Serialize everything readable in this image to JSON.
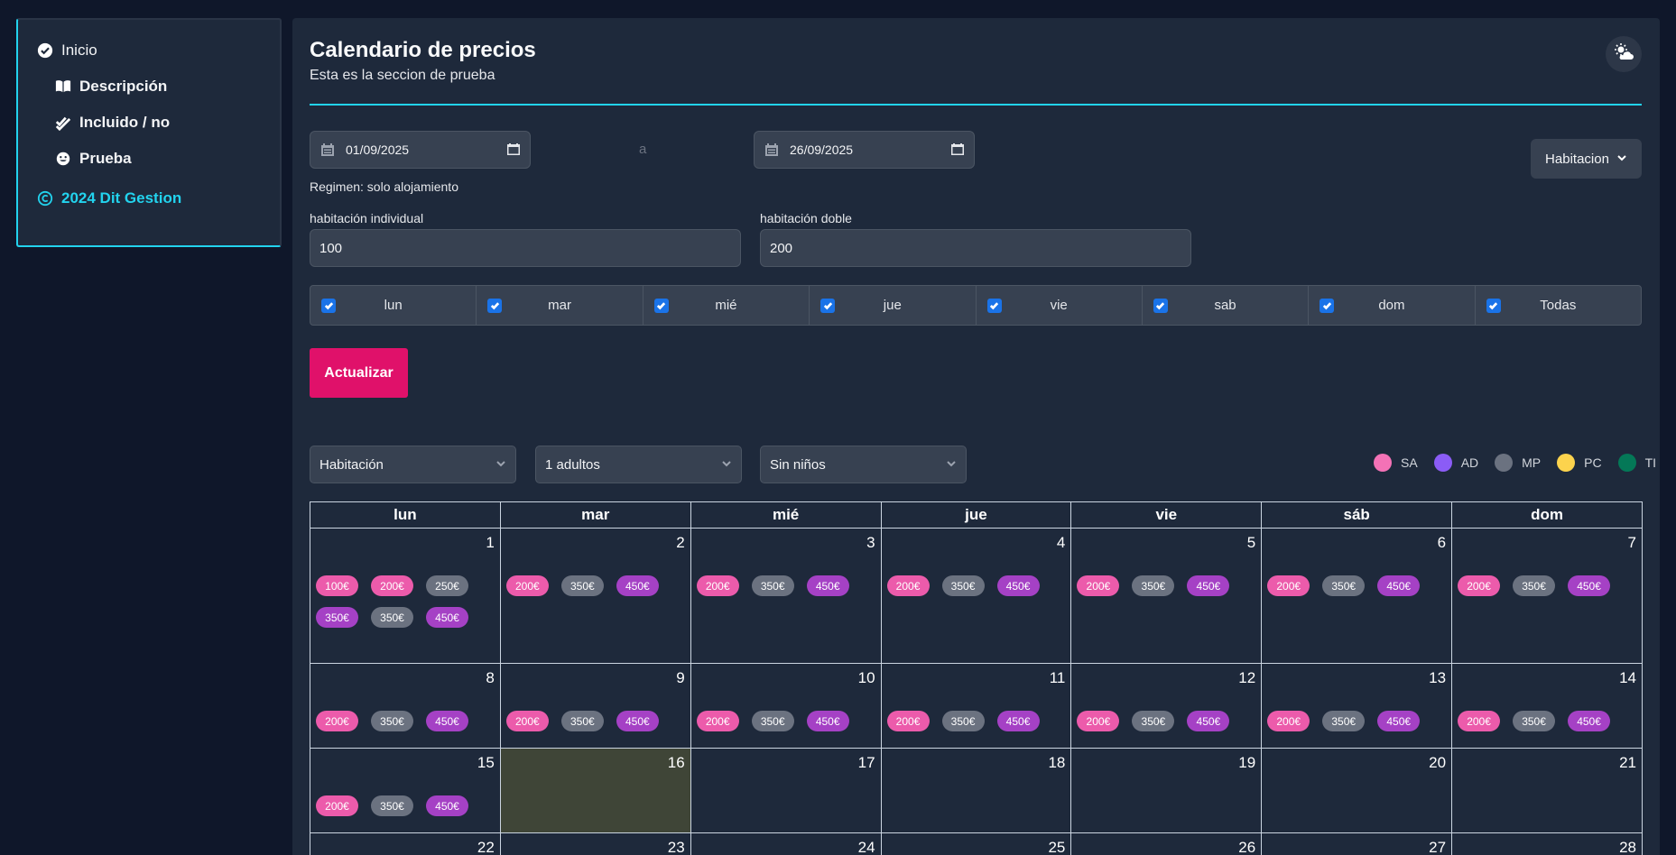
{
  "sidebar": {
    "items": [
      {
        "label": "Inicio",
        "icon": "check-circle-icon"
      },
      {
        "label": "Descripción",
        "icon": "book-icon"
      },
      {
        "label": "Incluido / no",
        "icon": "double-check-icon"
      },
      {
        "label": "Prueba",
        "icon": "smile-icon"
      }
    ],
    "footer": "2024 Dit Gestion"
  },
  "header": {
    "title": "Calendario de precios",
    "subtitle": "Esta es la seccion de prueba"
  },
  "range": {
    "from": "01/09/2025",
    "separator": "a",
    "to": "26/09/2025"
  },
  "room_select": "Habitacion",
  "regimen": "Regimen: solo alojamiento",
  "prices": {
    "single_label": "habitación individual",
    "single_value": "100",
    "double_label": "habitación doble",
    "double_value": "200"
  },
  "weekdays": [
    "lun",
    "mar",
    "mié",
    "jue",
    "vie",
    "sab",
    "dom",
    "Todas"
  ],
  "update_button": "Actualizar",
  "filters": {
    "room": "Habitación",
    "adults": "1 adultos",
    "children": "Sin niños"
  },
  "legend": [
    {
      "code": "SA",
      "color": "#f472b6"
    },
    {
      "code": "AD",
      "color": "#8b5cf6"
    },
    {
      "code": "MP",
      "color": "#6b7280"
    },
    {
      "code": "PC",
      "color": "#fcd34d"
    },
    {
      "code": "TI",
      "color": "#047857"
    }
  ],
  "calendar": {
    "headers": [
      "lun",
      "mar",
      "mié",
      "jue",
      "vie",
      "sáb",
      "dom"
    ],
    "today": 16,
    "weeks": [
      [
        {
          "day": "1",
          "prices": [
            [
              "100€",
              "SA"
            ],
            [
              "200€",
              "SA"
            ],
            [
              "250€",
              "MP"
            ],
            [
              "350€",
              "AD"
            ],
            [
              "350€",
              "MP"
            ],
            [
              "450€",
              "AD"
            ]
          ]
        },
        {
          "day": "2",
          "prices": [
            [
              "200€",
              "SA"
            ],
            [
              "350€",
              "MP"
            ],
            [
              "450€",
              "AD"
            ]
          ]
        },
        {
          "day": "3",
          "prices": [
            [
              "200€",
              "SA"
            ],
            [
              "350€",
              "MP"
            ],
            [
              "450€",
              "AD"
            ]
          ]
        },
        {
          "day": "4",
          "prices": [
            [
              "200€",
              "SA"
            ],
            [
              "350€",
              "MP"
            ],
            [
              "450€",
              "AD"
            ]
          ]
        },
        {
          "day": "5",
          "prices": [
            [
              "200€",
              "SA"
            ],
            [
              "350€",
              "MP"
            ],
            [
              "450€",
              "AD"
            ]
          ]
        },
        {
          "day": "6",
          "prices": [
            [
              "200€",
              "SA"
            ],
            [
              "350€",
              "MP"
            ],
            [
              "450€",
              "AD"
            ]
          ]
        },
        {
          "day": "7",
          "prices": [
            [
              "200€",
              "SA"
            ],
            [
              "350€",
              "MP"
            ],
            [
              "450€",
              "AD"
            ]
          ]
        }
      ],
      [
        {
          "day": "8",
          "prices": [
            [
              "200€",
              "SA"
            ],
            [
              "350€",
              "MP"
            ],
            [
              "450€",
              "AD"
            ]
          ]
        },
        {
          "day": "9",
          "prices": [
            [
              "200€",
              "SA"
            ],
            [
              "350€",
              "MP"
            ],
            [
              "450€",
              "AD"
            ]
          ]
        },
        {
          "day": "10",
          "prices": [
            [
              "200€",
              "SA"
            ],
            [
              "350€",
              "MP"
            ],
            [
              "450€",
              "AD"
            ]
          ]
        },
        {
          "day": "11",
          "prices": [
            [
              "200€",
              "SA"
            ],
            [
              "350€",
              "MP"
            ],
            [
              "450€",
              "AD"
            ]
          ]
        },
        {
          "day": "12",
          "prices": [
            [
              "200€",
              "SA"
            ],
            [
              "350€",
              "MP"
            ],
            [
              "450€",
              "AD"
            ]
          ]
        },
        {
          "day": "13",
          "prices": [
            [
              "200€",
              "SA"
            ],
            [
              "350€",
              "MP"
            ],
            [
              "450€",
              "AD"
            ]
          ]
        },
        {
          "day": "14",
          "prices": [
            [
              "200€",
              "SA"
            ],
            [
              "350€",
              "MP"
            ],
            [
              "450€",
              "AD"
            ]
          ]
        }
      ],
      [
        {
          "day": "15",
          "prices": [
            [
              "200€",
              "SA"
            ],
            [
              "350€",
              "MP"
            ],
            [
              "450€",
              "AD"
            ]
          ]
        },
        {
          "day": "16",
          "prices": []
        },
        {
          "day": "17",
          "prices": []
        },
        {
          "day": "18",
          "prices": []
        },
        {
          "day": "19",
          "prices": []
        },
        {
          "day": "20",
          "prices": []
        },
        {
          "day": "21",
          "prices": []
        }
      ],
      [
        {
          "day": "22",
          "prices": []
        },
        {
          "day": "23",
          "prices": []
        },
        {
          "day": "24",
          "prices": []
        },
        {
          "day": "25",
          "prices": []
        },
        {
          "day": "26",
          "prices": []
        },
        {
          "day": "27",
          "prices": []
        },
        {
          "day": "28",
          "prices": []
        }
      ]
    ]
  }
}
